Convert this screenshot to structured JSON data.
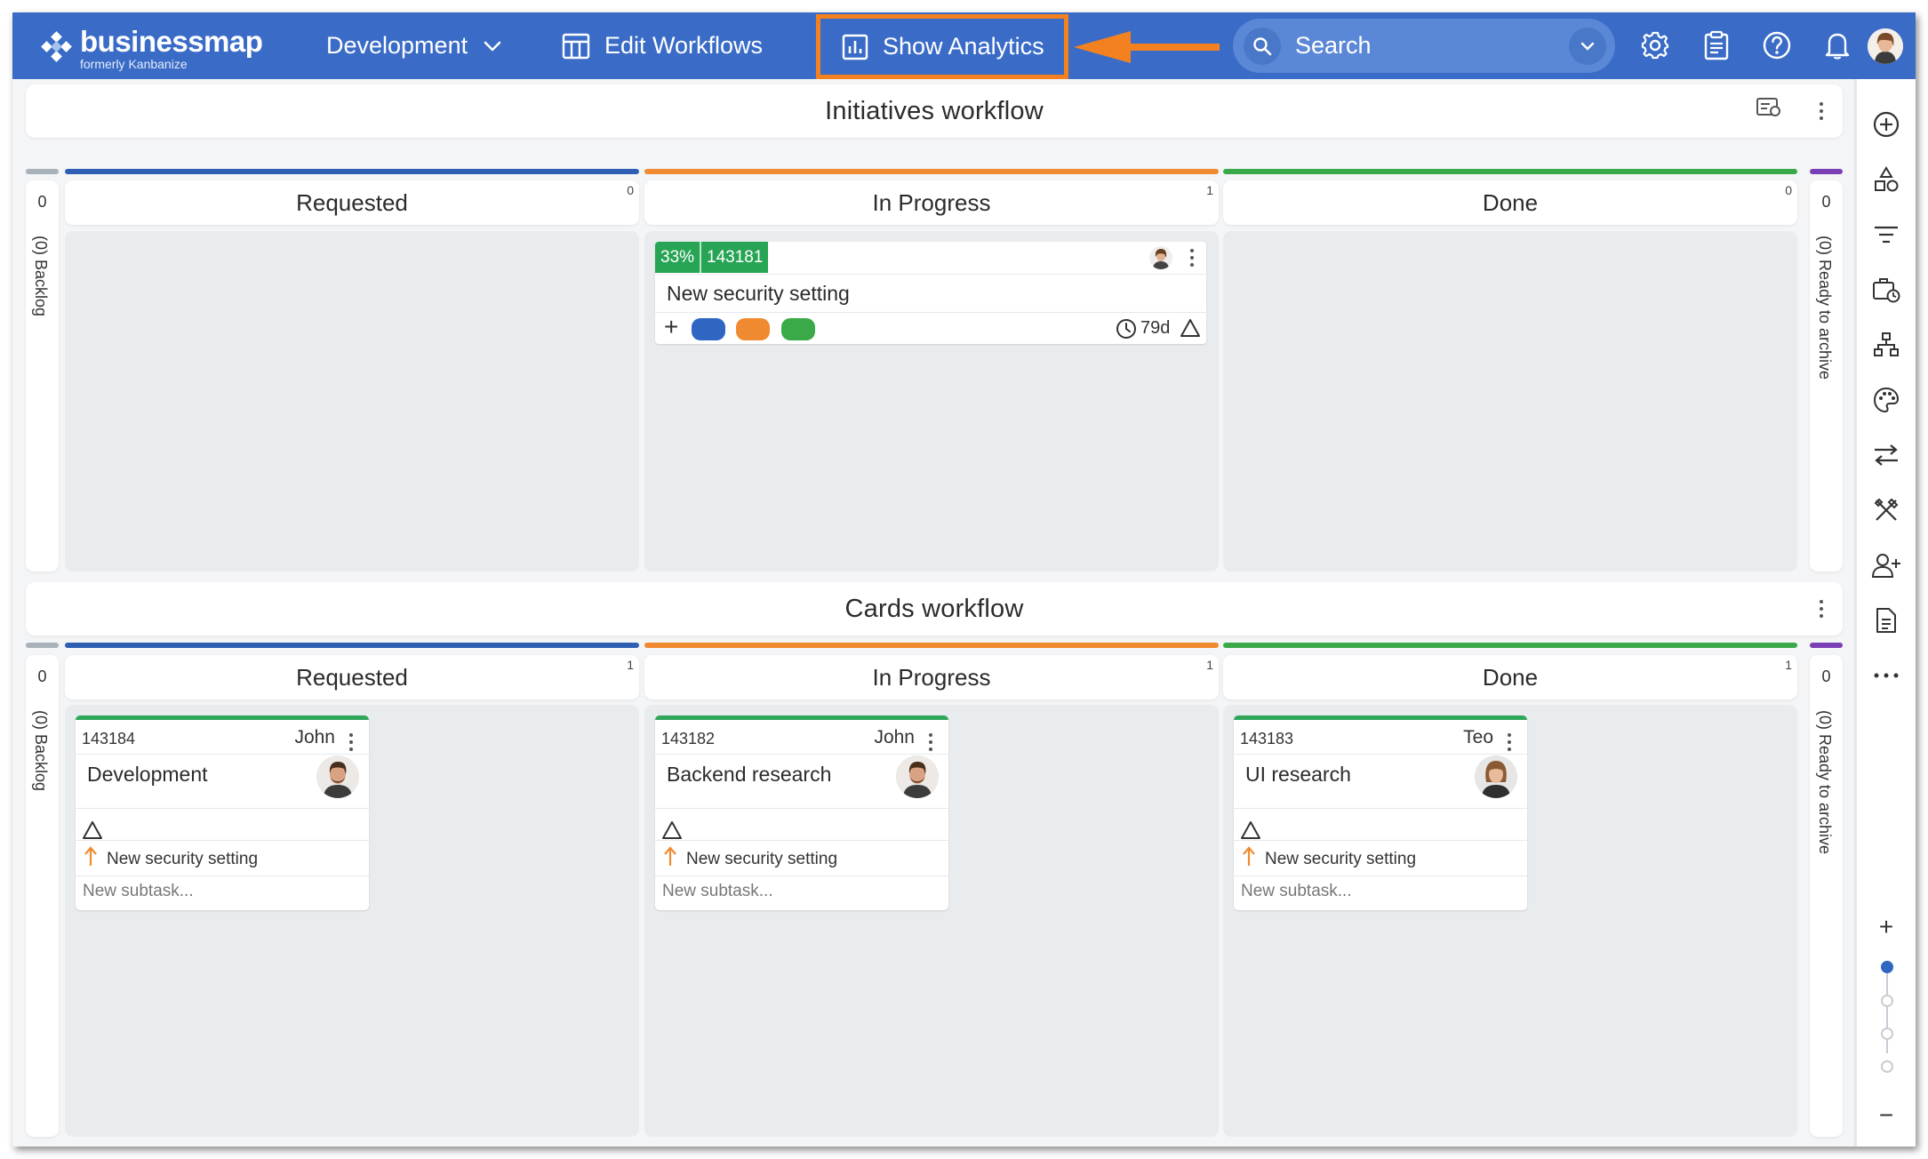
{
  "app": {
    "logo_name": "businessmap",
    "logo_sub": "formerly Kanbanize"
  },
  "nav": {
    "board_menu": "Development",
    "edit_workflows": "Edit Workflows",
    "show_analytics": "Show Analytics",
    "search_placeholder": "Search"
  },
  "colors": {
    "nav_bg": "#3a6cc7",
    "highlight": "#f4811f",
    "requested": "#2f5fb3",
    "in_progress": "#f08a30",
    "done": "#3aaa48",
    "archive": "#7b3fb5",
    "backlog": "#a9b1ba",
    "card_green": "#27a555"
  },
  "initiatives": {
    "title": "Initiatives workflow",
    "backlog": {
      "count": "0",
      "label": "(0) Backlog"
    },
    "archive": {
      "count": "0",
      "label": "(0) Ready to archive"
    },
    "columns": [
      {
        "name": "Requested",
        "count": "0"
      },
      {
        "name": "In Progress",
        "count": "1"
      },
      {
        "name": "Done",
        "count": "0"
      }
    ],
    "card": {
      "progress": "33%",
      "id": "143181",
      "title": "New security setting",
      "age": "79d",
      "add": "+"
    }
  },
  "cards_wf": {
    "title": "Cards workflow",
    "backlog": {
      "count": "0",
      "label": "(0) Backlog"
    },
    "archive": {
      "count": "0",
      "label": "(0) Ready to archive"
    },
    "columns": [
      {
        "name": "Requested",
        "count": "1"
      },
      {
        "name": "In Progress",
        "count": "1"
      },
      {
        "name": "Done",
        "count": "1"
      }
    ],
    "cards": [
      {
        "id": "143184",
        "owner": "John",
        "title": "Development",
        "parent": "New security setting",
        "subtask": "New subtask..."
      },
      {
        "id": "143182",
        "owner": "John",
        "title": "Backend research",
        "parent": "New security setting",
        "subtask": "New subtask..."
      },
      {
        "id": "143183",
        "owner": "Teo",
        "title": "UI research",
        "parent": "New security setting",
        "subtask": "New subtask..."
      }
    ]
  },
  "zoom": {
    "plus": "+",
    "minus": "−"
  }
}
